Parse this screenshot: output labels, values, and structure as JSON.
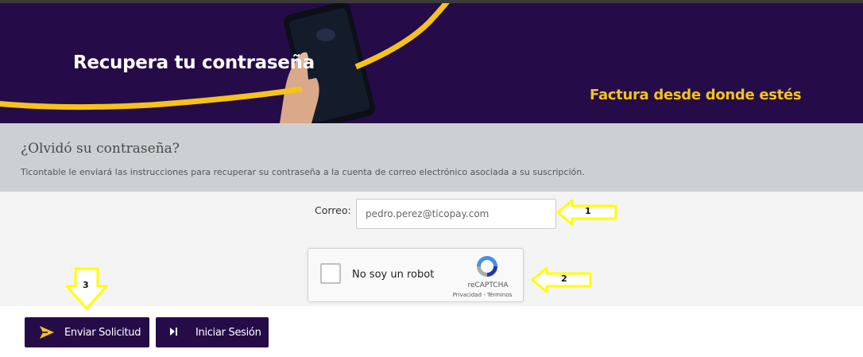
{
  "banner": {
    "title": "Recupera tu contraseña",
    "tagline": "Factura desde donde estés"
  },
  "info": {
    "title": "¿Olvidó su contraseña?",
    "description": "Ticontable le enviará las instrucciones para recuperar su contraseña a la cuenta de correo electrónico asociada a su suscripción."
  },
  "form": {
    "email_label": "Correo:",
    "email_value": "pedro.perez@ticopay.com"
  },
  "captcha": {
    "label": "No soy un robot",
    "brand": "reCAPTCHA",
    "links": "Privacidad - Términos"
  },
  "annotations": {
    "marker_1": "1",
    "marker_2": "2",
    "marker_3": "3"
  },
  "buttons": {
    "send_label": "Enviar Solicitud",
    "login_label": "Iniciar Sesión"
  },
  "colors": {
    "brand": "#250c48",
    "accent": "#f5c31b",
    "marker": "#ffff00"
  }
}
